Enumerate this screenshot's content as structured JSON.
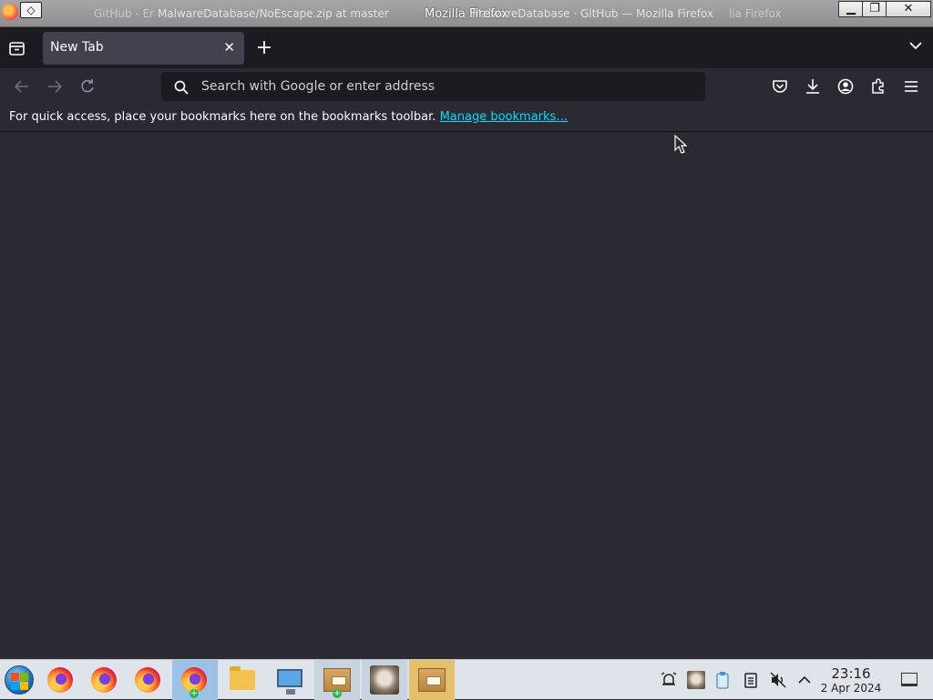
{
  "window": {
    "title": "Mozilla Firefox",
    "ghost_titles": [
      "GitHub - Er",
      "MalwareDatabase/NoEscape.zip at master",
      "MalwareDatabase · GitHub — Mozilla Firefox",
      "lla Firefox"
    ],
    "menu_glyph": "◇",
    "controls": {
      "minimize": "▁",
      "restore": "❐",
      "close": "✕"
    }
  },
  "tabs": [
    {
      "label": "New Tab",
      "close": "✕",
      "active": true
    }
  ],
  "tabstrip": {
    "new_tab_glyph": "+"
  },
  "urlbar": {
    "placeholder": "Search with Google or enter address",
    "value": ""
  },
  "bookmarks_toolbar": {
    "message": "For quick access, place your bookmarks here on the bookmarks toolbar.",
    "link": "Manage bookmarks…"
  },
  "toolbar_icons": [
    "pocket-icon",
    "downloads-icon",
    "account-icon",
    "extensions-icon",
    "menu-icon"
  ],
  "taskbar": {
    "items": [
      "start-menu",
      "firefox",
      "firefox",
      "firefox",
      "firefox-active",
      "file-manager",
      "system-monitor",
      "archive-manager",
      "cat-image",
      "archive-package"
    ],
    "clock": {
      "time": "23:16",
      "date": "2 Apr 2024"
    },
    "tray": [
      "alarm-icon",
      "cat-app-icon",
      "clipboard-app-icon",
      "clipboard-icon",
      "volume-muted-icon",
      "tray-expand-icon"
    ]
  },
  "colors": {
    "toolbar_bg": "#2b2a33",
    "tabstrip_bg": "#1c1b22",
    "tab_active_bg": "#42414d",
    "link": "#00ddff",
    "taskbar_bg": "#dfe4ea"
  }
}
